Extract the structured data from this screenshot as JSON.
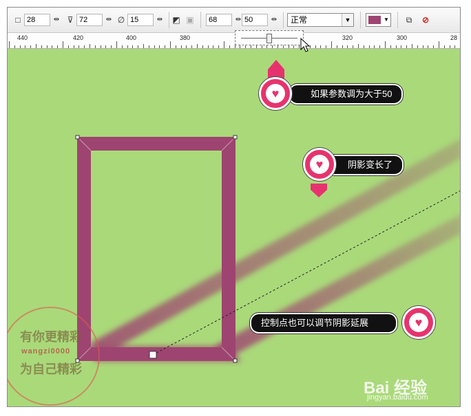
{
  "toolbar": {
    "field1_value": "28",
    "field2_value": "72",
    "field3_value": "15",
    "offset_x_value": "68",
    "offset_y_value": "50",
    "blend_mode": "正常",
    "shadow_color": "#9e4470"
  },
  "ruler": {
    "labels": [
      "440",
      "420",
      "400",
      "380",
      "320",
      "300",
      "28"
    ]
  },
  "callouts": {
    "top_text": "如果参数调为大于50",
    "middle_text": "阴影变长了",
    "bottom_text": "控制点也可以调节阴影延展"
  },
  "watermark": {
    "line1": "有你更精彩",
    "line2": "wangzi0000",
    "line3": "为自己精彩"
  },
  "baidu": {
    "logo": "Bai 经验",
    "url": "jingyan.baidu.com"
  },
  "colors": {
    "canvas_bg": "#aad97a",
    "rect_stroke": "#9e4470",
    "callout_badge": "#e6336e"
  }
}
